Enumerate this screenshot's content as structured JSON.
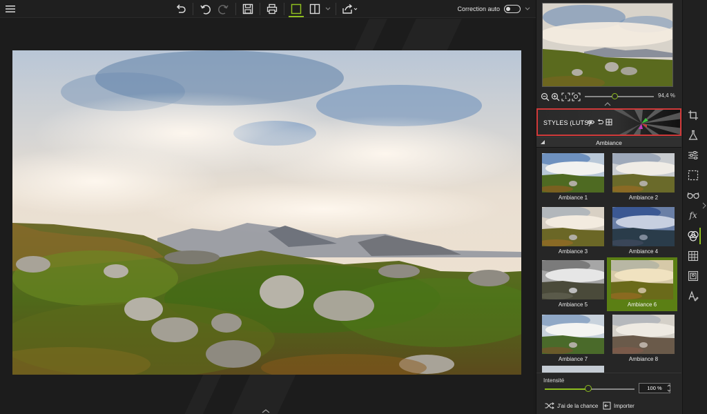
{
  "toolbar": {
    "autocorrect_label": "Correction auto",
    "icons": [
      "menu-icon",
      "undo-all-icon",
      "undo-icon",
      "redo-icon",
      "save-icon",
      "print-icon",
      "single-view-icon",
      "split-view-icon",
      "chevron-down-icon",
      "share-icon"
    ]
  },
  "navigator": {
    "zoom_value": "94,4 %",
    "zoom_fraction": 0.45
  },
  "styles": {
    "title": "STYLES (LUTS)",
    "group": "Ambiance",
    "items": [
      {
        "label": "Ambiance 1"
      },
      {
        "label": "Ambiance 2"
      },
      {
        "label": "Ambiance 3"
      },
      {
        "label": "Ambiance 4"
      },
      {
        "label": "Ambiance 5"
      },
      {
        "label": "Ambiance 6",
        "selected": true
      },
      {
        "label": "Ambiance 7"
      },
      {
        "label": "Ambiance 8"
      }
    ]
  },
  "intensity": {
    "label": "Intensité",
    "value": "100 %",
    "slider_fraction": 0.5
  },
  "actions": {
    "random_label": "J'ai de la chance",
    "import_label": "Importer"
  },
  "side_tools": [
    "crop-icon",
    "flask-icon",
    "sliders-icon",
    "selection-icon",
    "glasses-icon",
    "fx-icon",
    "styles-luts-icon",
    "texture-icon",
    "frame-icon",
    "text-icon"
  ],
  "colors": {
    "accent": "#8fbf1f",
    "highlight_border": "#d23a3a",
    "selected_card": "#5b7f14"
  }
}
